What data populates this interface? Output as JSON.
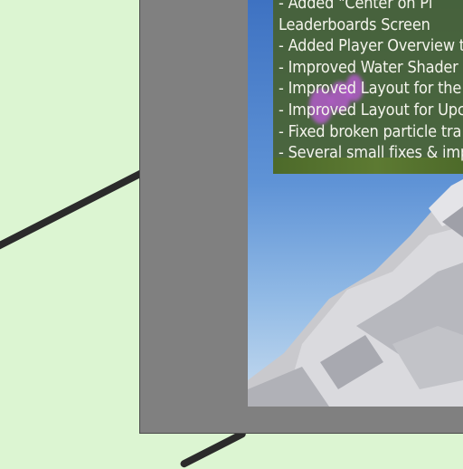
{
  "patch_notes": {
    "lines": [
      "- Added \"Center on Pl",
      "Leaderboards Screen",
      "- Added Player Overview t",
      "- Improved Water Shader",
      "- Improved Layout for the",
      "- Improved Layout for Upc",
      "- Fixed broken particle tra",
      "- Several small fixes & imp"
    ]
  },
  "colors": {
    "background": "#dcf5d2",
    "frame": "#808080",
    "panel": "#48602a",
    "sky": "#5f93d6"
  }
}
